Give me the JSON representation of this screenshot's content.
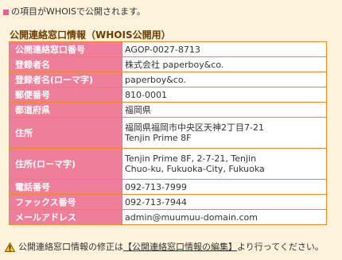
{
  "notice": {
    "text": "の項目がWHOISで公開されます。"
  },
  "section": {
    "title": "公開連絡窓口情報（WHOIS公開用）"
  },
  "rows": [
    {
      "label": "公開連絡窓口番号",
      "value": "AGOP-0027-8713"
    },
    {
      "label": "登録者名",
      "value": "株式会社 paperboy&co."
    },
    {
      "label": "登録者名(ローマ字)",
      "value": "paperboy&co."
    },
    {
      "label": "郵便番号",
      "value": "810-0001"
    },
    {
      "label": "都道府県",
      "value": "福岡県"
    },
    {
      "label": "住所",
      "value_line1": "福岡県福岡市中央区天神2丁目7-21",
      "value_line2": "Tenjin Prime 8F"
    },
    {
      "label": "住所(ローマ字)",
      "value_line1": "Tenjin Prime 8F, 2-7-21, Tenjin",
      "value_line2": "Chuo-ku, Fukuoka-City, Fukuoka"
    },
    {
      "label": "電話番号",
      "value": "092-713-7999"
    },
    {
      "label": "ファックス番号",
      "value": "092-713-7944"
    },
    {
      "label": "メールアドレス",
      "value": "admin@muumuu-domain.com"
    }
  ],
  "footer": {
    "prefix": "公開連絡窓口情報の修正は",
    "link": "【公開連絡窓口情報の編集】",
    "suffix": "より行ってください。"
  },
  "colors": {
    "background": "#fdf3dc",
    "label_bg": "#ef7e9a",
    "border": "#f08a1f",
    "title": "#6b3d00",
    "marker": "#e85f9a"
  }
}
